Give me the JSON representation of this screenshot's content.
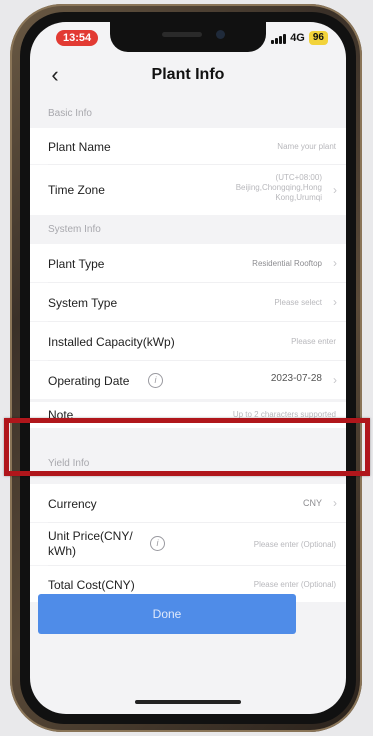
{
  "status_bar": {
    "time": "13:54",
    "network": "4G",
    "battery": "96"
  },
  "nav": {
    "title": "Plant Info",
    "back_glyph": "‹"
  },
  "sections": {
    "basic": "Basic Info",
    "system": "System Info",
    "yield": "Yield Info"
  },
  "fields": {
    "plant_name": {
      "label": "Plant Name",
      "placeholder": "Name your plant"
    },
    "time_zone": {
      "label": "Time Zone",
      "value_line1": "(UTC+08:00)",
      "value_line2": "Beijing,Chongqing,Hong",
      "value_line3": "Kong,Urumqi"
    },
    "plant_type": {
      "label": "Plant Type",
      "value": "Residential Rooftop"
    },
    "system_type": {
      "label": "System Type",
      "placeholder": "Please select"
    },
    "installed_capacity": {
      "label": "Installed Capacity(kWp)",
      "placeholder": "Please enter"
    },
    "operating_date": {
      "label": "Operating Date",
      "value": "2023-07-28"
    },
    "note": {
      "label": "Note",
      "placeholder": "Up to 2 characters supported"
    },
    "currency": {
      "label": "Currency",
      "value": "CNY"
    },
    "unit_price": {
      "label_line1": "Unit Price(CNY/",
      "label_line2": "kWh)",
      "placeholder": "Please enter (Optional)"
    },
    "total_cost": {
      "label": "Total Cost(CNY)",
      "placeholder": "Please enter (Optional)"
    }
  },
  "done_label": "Done",
  "colors": {
    "accent": "#4f8ce8",
    "highlight": "#b0161b",
    "status_red": "#e23a33",
    "battery": "#f2d33b"
  },
  "icons": {
    "back": "chevron-left-icon",
    "chevron": "chevron-right-icon",
    "info": "info-icon"
  }
}
